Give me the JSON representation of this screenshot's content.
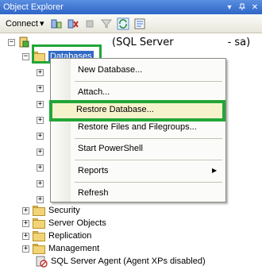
{
  "window": {
    "title": "Object Explorer",
    "pin_glyph": "▾",
    "autohide_glyph": "ᚔ",
    "close_glyph": "✕"
  },
  "toolbar": {
    "connect_label": "Connect",
    "connect_dropdown": "▾",
    "icons": [
      "connect-object-explorer-icon",
      "disconnect-icon",
      "stop-icon",
      "filter-icon",
      "refresh-icon",
      "summary-icon"
    ]
  },
  "tree": {
    "server_name": "(SQL Server",
    "server_user": "- sa)",
    "databases_label": "Databases",
    "collapsed_nodes": [
      "Security",
      "Server Objects",
      "Replication",
      "Management"
    ],
    "agent_label": "SQL Server Agent (Agent XPs disabled)"
  },
  "context_menu": {
    "items": [
      {
        "label": "New Database..."
      },
      {
        "label": "Attach..."
      },
      {
        "label": "Restore Database..."
      },
      {
        "label": "Restore Files and Filegroups..."
      },
      {
        "label": "Start PowerShell"
      },
      {
        "label": "Reports"
      },
      {
        "label": "Refresh"
      }
    ],
    "submenu_arrow": "▶"
  },
  "colors": {
    "highlight_border": "#22a637",
    "selection": "#316ac5",
    "titlebar": "#2e66c8"
  }
}
